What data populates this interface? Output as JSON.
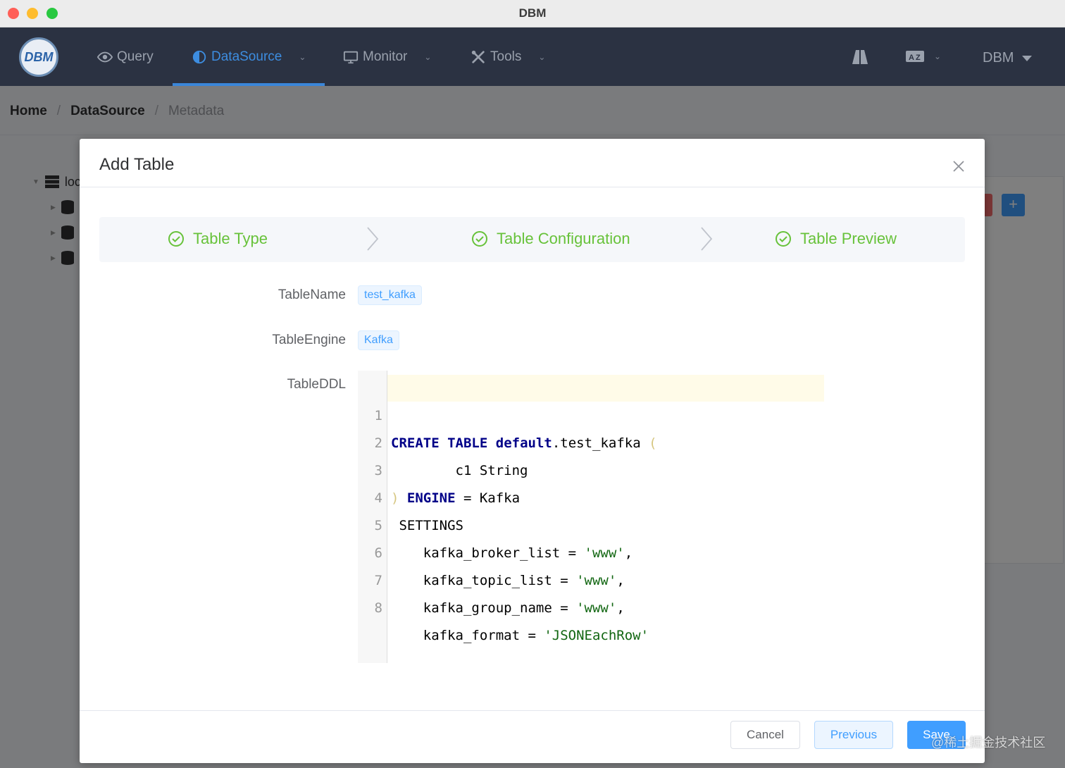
{
  "window": {
    "title": "DBM"
  },
  "navbar": {
    "logo_text": "DBM",
    "items": [
      {
        "label": "Query",
        "icon": "eye-icon"
      },
      {
        "label": "DataSource",
        "icon": "half-circle-icon",
        "active": true
      },
      {
        "label": "Monitor",
        "icon": "monitor-icon"
      },
      {
        "label": "Tools",
        "icon": "tools-icon"
      }
    ],
    "user_label": "DBM"
  },
  "breadcrumb": {
    "home": "Home",
    "datasource": "DataSource",
    "current": "Metadata"
  },
  "tree": {
    "root_label": "loc"
  },
  "dialog": {
    "title": "Add Table",
    "steps": [
      "Table Type",
      "Table Configuration",
      "Table Preview"
    ],
    "form": {
      "table_name_label": "TableName",
      "table_name_value": "test_kafka",
      "table_engine_label": "TableEngine",
      "table_engine_value": "Kafka",
      "table_ddl_label": "TableDDL"
    },
    "ddl_line_numbers": [
      "1",
      "2",
      "3",
      "4",
      "5",
      "6",
      "7",
      "8"
    ],
    "ddl": {
      "l1_kw1": "CREATE",
      "l1_kw2": "TABLE",
      "l1_kw3": "default",
      "l1_rest": ".test_kafka ",
      "l1_paren": "(",
      "l2": "        c1 String",
      "l3_paren": ")",
      "l3_kw": "ENGINE",
      "l3_rest": " = Kafka",
      "l4": " SETTINGS",
      "l5_key": "    kafka_broker_list = ",
      "l5_val": "'www'",
      "l5_end": ",",
      "l6_key": "    kafka_topic_list = ",
      "l6_val": "'www'",
      "l6_end": ",",
      "l7_key": "    kafka_group_name = ",
      "l7_val": "'www'",
      "l7_end": ",",
      "l8_key": "    kafka_format = ",
      "l8_val": "'JSONEachRow'"
    },
    "buttons": {
      "cancel": "Cancel",
      "previous": "Previous",
      "save": "Save"
    }
  },
  "watermark": "@稀土掘金技术社区",
  "colors": {
    "accent": "#409eff",
    "success": "#67c23a",
    "navbar": "#2b3242"
  }
}
